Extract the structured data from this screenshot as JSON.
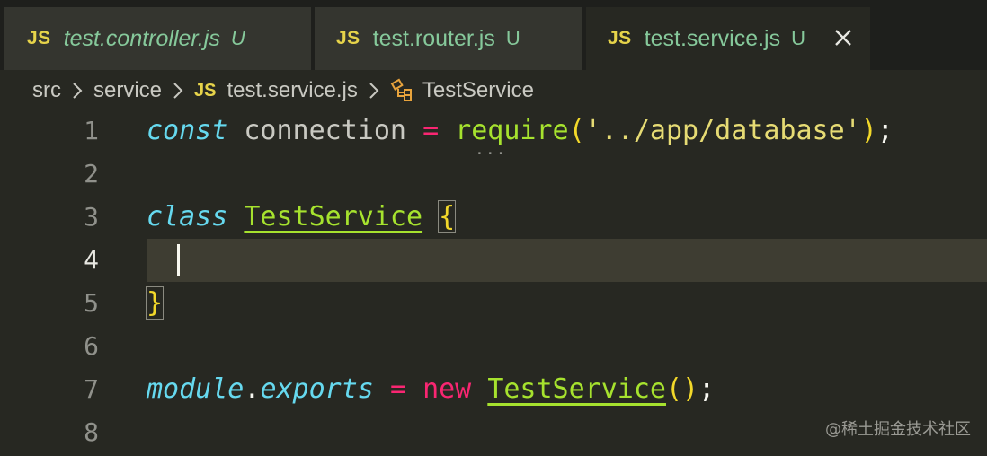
{
  "tabs": [
    {
      "badge": "JS",
      "name": "test.controller.js",
      "status": "U",
      "italic": true,
      "active": false
    },
    {
      "badge": "JS",
      "name": "test.router.js",
      "status": "U",
      "italic": false,
      "active": false
    },
    {
      "badge": "JS",
      "name": "test.service.js",
      "status": "U",
      "italic": false,
      "active": true
    }
  ],
  "breadcrumb": {
    "items": [
      "src",
      "service",
      "test.service.js",
      "TestService"
    ],
    "file_badge": "JS"
  },
  "editor": {
    "line_numbers": [
      "1",
      "2",
      "3",
      "4",
      "5",
      "6",
      "7",
      "8"
    ],
    "active_line": 4,
    "line1": {
      "kw": "const",
      "var": " connection ",
      "op": "=",
      "fn": "require",
      "open": "(",
      "str": "'../app/database'",
      "close": ")",
      "end": ";"
    },
    "line3": {
      "kw": "class",
      "cls": "TestService",
      "brace": "{"
    },
    "line5": {
      "brace": "}"
    },
    "line7": {
      "obj": "module",
      "dot": ".",
      "prop": "exports",
      "op": "=",
      "new": "new",
      "cls": "TestService",
      "parens": "()",
      "end": ";"
    },
    "ellipsis": "..."
  },
  "watermark": "@稀土掘金技术社区",
  "colors": {
    "background": "#272822",
    "tabbar": "#1e1f1c",
    "keyword": "#66d9ef",
    "function": "#a6e22e",
    "string": "#e6db74",
    "operator": "#f92672",
    "bracket": "#f2d82a",
    "untracked": "#86c99b"
  }
}
